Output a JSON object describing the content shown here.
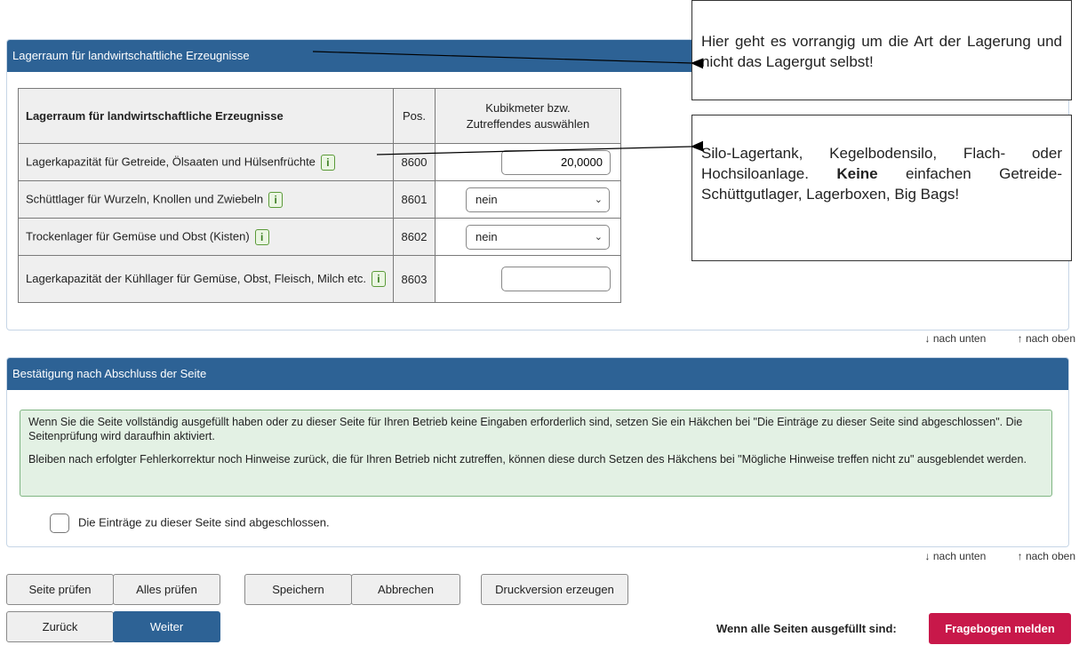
{
  "section1": {
    "header": "Lagerraum für landwirtschaftliche Erzeugnisse",
    "table": {
      "col_name": "Lagerraum für landwirtschaftliche Erzeugnisse",
      "col_pos": "Pos.",
      "col_kub_line1": "Kubikmeter bzw.",
      "col_kub_line2": "Zutreffendes auswählen",
      "rows": [
        {
          "label": "Lagerkapazität für Getreide, Ölsaaten und Hülsenfrüchte",
          "pos": "8600",
          "value": "20,0000"
        },
        {
          "label": "Schüttlager für Wurzeln, Knollen und Zwiebeln",
          "pos": "8601",
          "value": "nein"
        },
        {
          "label": "Trockenlager für Gemüse und Obst (Kisten)",
          "pos": "8602",
          "value": "nein"
        },
        {
          "label": "Lagerkapazität der Kühllager für Gemüse, Obst, Fleisch, Milch etc.",
          "pos": "8603",
          "value": ""
        }
      ]
    }
  },
  "nav": {
    "down": "↓ nach unten",
    "up": "↑ nach oben"
  },
  "section2": {
    "header": "Bestätigung nach Abschluss der Seite",
    "notice_p1": "Wenn Sie die Seite vollständig ausgefüllt haben oder zu dieser Seite für Ihren Betrieb keine Eingaben erforderlich sind, setzen Sie ein Häkchen bei \"Die Einträge zu dieser Seite sind abgeschlossen\". Die Seitenprüfung wird daraufhin aktiviert.",
    "notice_p2": "Bleiben nach erfolgter Fehlerkorrektur noch Hinweise zurück, die für Ihren Betrieb nicht zutreffen, können diese durch Setzen des Häkchens bei \"Mögliche Hinweise treffen nicht zu\" ausgeblendet werden.",
    "checkbox_label": "Die Einträge zu dieser Seite sind abgeschlossen."
  },
  "buttons": {
    "seite_pruefen": "Seite prüfen",
    "alles_pruefen": "Alles prüfen",
    "speichern": "Speichern",
    "abbrechen": "Abbrechen",
    "druckversion": "Druckversion erzeugen",
    "zurueck": "Zurück",
    "weiter": "Weiter",
    "final_label": "Wenn alle Seiten ausgefüllt sind:",
    "fragebogen": "Fragebogen melden"
  },
  "callouts": {
    "c1": "Hier geht es vorrangig um die Art der Lagerung und nicht das Lagergut selbst!",
    "c2_part1": "Silo-Lagertank, Kegelbodensilo, Flach- oder Hochsiloanlage.",
    "c2_bold": "Keine",
    "c2_part2": "einfachen Getreide-Schüttgutlager, Lagerboxen, Big Bags!"
  },
  "colors": {
    "header_blue": "#2d6295",
    "notice_green": "#e3f1e4",
    "danger": "#c8184a"
  }
}
